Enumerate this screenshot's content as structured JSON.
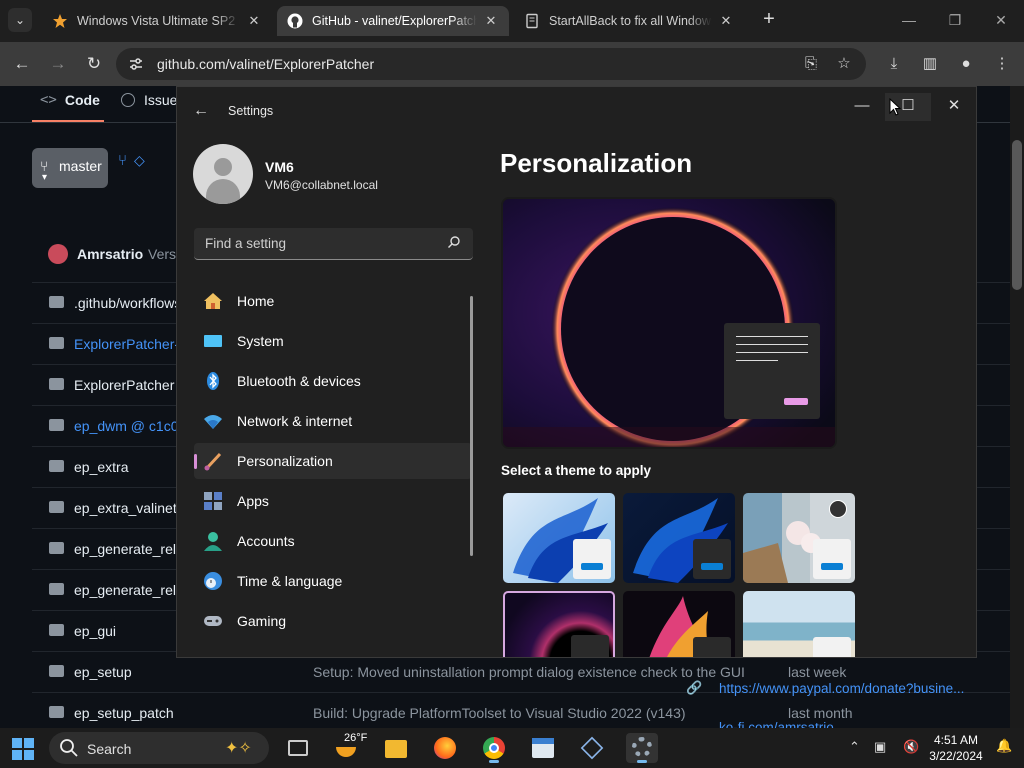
{
  "browser": {
    "tabs": [
      {
        "title": "Windows Vista Ultimate SP2 (64-bit)",
        "icon": "star-icon",
        "active": false
      },
      {
        "title": "GitHub - valinet/ExplorerPatcher",
        "icon": "github-icon",
        "active": true
      },
      {
        "title": "StartAllBack to fix all Windows 11",
        "icon": "document-icon",
        "active": false
      }
    ],
    "close_glyph": "✕",
    "new_tab": "+",
    "url": "github.com/valinet/ExplorerPatcher"
  },
  "github": {
    "tabs": {
      "code": "Code",
      "issues": "Issues"
    },
    "branch": "master",
    "commit_author": "Amrsatrio",
    "commit_prefix": "Versi",
    "files": [
      {
        "name": ".github/workflows",
        "type": "folder",
        "link": false,
        "message": "",
        "when": ""
      },
      {
        "name": "ExplorerPatcher-",
        "type": "submodule",
        "link": true,
        "message": "",
        "when": ""
      },
      {
        "name": "ExplorerPatcher",
        "type": "folder",
        "link": false,
        "message": "",
        "when": ""
      },
      {
        "name": "ep_dwm @ c1c0",
        "type": "submodule",
        "link": true,
        "message": "",
        "when": ""
      },
      {
        "name": "ep_extra",
        "type": "folder",
        "link": false,
        "message": "",
        "when": ""
      },
      {
        "name": "ep_extra_valinet.",
        "type": "folder",
        "link": false,
        "message": "",
        "when": ""
      },
      {
        "name": "ep_generate_rele",
        "type": "folder",
        "link": false,
        "message": "",
        "when": ""
      },
      {
        "name": "ep_generate_rele",
        "type": "folder",
        "link": false,
        "message": "",
        "when": ""
      },
      {
        "name": "ep_gui",
        "type": "folder",
        "link": false,
        "message": "",
        "when": ""
      },
      {
        "name": "ep_setup",
        "type": "folder",
        "link": false,
        "message": "Setup: Moved uninstallation prompt dialog existence check to the GUI",
        "when": "last week"
      },
      {
        "name": "ep_setup_patch",
        "type": "folder",
        "link": false,
        "message": "Build: Upgrade PlatformToolset to Visual Studio 2022 (v143)",
        "when": "last month"
      }
    ],
    "sponsor_link": "https://www.paypal.com/donate?busine...",
    "sponsor_link2": "ko-fi.com/amrsatrio"
  },
  "settings": {
    "window_title": "Settings",
    "user_name": "VM6",
    "user_email": "VM6@collabnet.local",
    "search_placeholder": "Find a setting",
    "nav": [
      {
        "label": "Home",
        "icon": "home-icon",
        "selected": false
      },
      {
        "label": "System",
        "icon": "display-icon",
        "selected": false
      },
      {
        "label": "Bluetooth & devices",
        "icon": "bluetooth-icon",
        "selected": false
      },
      {
        "label": "Network & internet",
        "icon": "wifi-icon",
        "selected": false
      },
      {
        "label": "Personalization",
        "icon": "brush-icon",
        "selected": true
      },
      {
        "label": "Apps",
        "icon": "apps-icon",
        "selected": false
      },
      {
        "label": "Accounts",
        "icon": "person-icon",
        "selected": false
      },
      {
        "label": "Time & language",
        "icon": "globe-clock-icon",
        "selected": false
      },
      {
        "label": "Gaming",
        "icon": "gamepad-icon",
        "selected": false
      }
    ],
    "page_title": "Personalization",
    "theme_label": "Select a theme to apply"
  },
  "taskbar": {
    "search_label": "Search",
    "weather": "26°F",
    "time": "4:51 AM",
    "date": "3/22/2024"
  }
}
